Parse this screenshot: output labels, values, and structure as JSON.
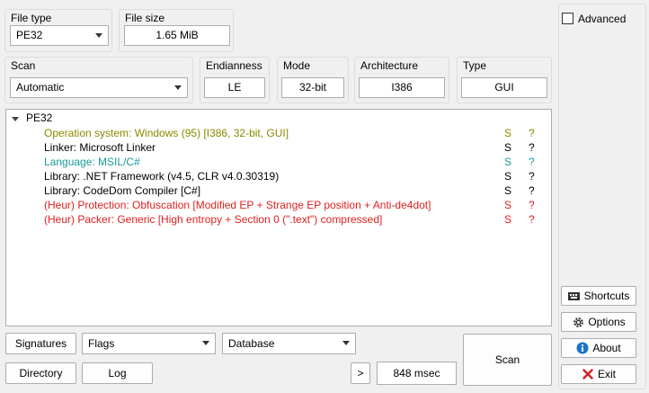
{
  "file_type": {
    "title": "File type",
    "value": "PE32"
  },
  "file_size": {
    "title": "File size",
    "value": "1.65 MiB"
  },
  "scan_group": {
    "title": "Scan",
    "value": "Automatic"
  },
  "endianness": {
    "title": "Endianness",
    "value": "LE"
  },
  "mode": {
    "title": "Mode",
    "value": "32-bit"
  },
  "architecture": {
    "title": "Architecture",
    "value": "I386"
  },
  "type": {
    "title": "Type",
    "value": "GUI"
  },
  "tree": {
    "root": "PE32",
    "rows": [
      {
        "name": "Operation system: Windows (95) [I386, 32-bit, GUI]",
        "s": "S",
        "q": "?",
        "color": "#8a8a00"
      },
      {
        "name": "Linker: Microsoft Linker",
        "s": "S",
        "q": "?",
        "color": "#000000"
      },
      {
        "name": "Language: MSIL/C#",
        "s": "S",
        "q": "?",
        "color": "#1a9a9a"
      },
      {
        "name": "Library: .NET Framework (v4.5, CLR v4.0.30319)",
        "s": "S",
        "q": "?",
        "color": "#000000"
      },
      {
        "name": "Library: CodeDom Compiler [C#]",
        "s": "S",
        "q": "?",
        "color": "#000000"
      },
      {
        "name": "(Heur) Protection: Obfuscation [Modified EP + Strange EP position + Anti-de4dot]",
        "s": "S",
        "q": "?",
        "color": "#e02020"
      },
      {
        "name": "(Heur) Packer: Generic [High entropy + Section 0 (\".text\") compressed]",
        "s": "S",
        "q": "?",
        "color": "#e02020"
      }
    ]
  },
  "bottom": {
    "signatures": "Signatures",
    "flags": "Flags",
    "database": "Database",
    "directory": "Directory",
    "log": "Log",
    "more": ">",
    "time": "848 msec",
    "scan": "Scan"
  },
  "right": {
    "advanced": "Advanced",
    "shortcuts": "Shortcuts",
    "options": "Options",
    "about": "About",
    "exit": "Exit"
  },
  "colors": {
    "info_blue": "#1a73c8",
    "exit_red": "#d32020"
  },
  "icons": [
    "shortcuts-icon",
    "gear-icon",
    "info-icon",
    "exit-icon",
    "chevron-down-icon"
  ]
}
